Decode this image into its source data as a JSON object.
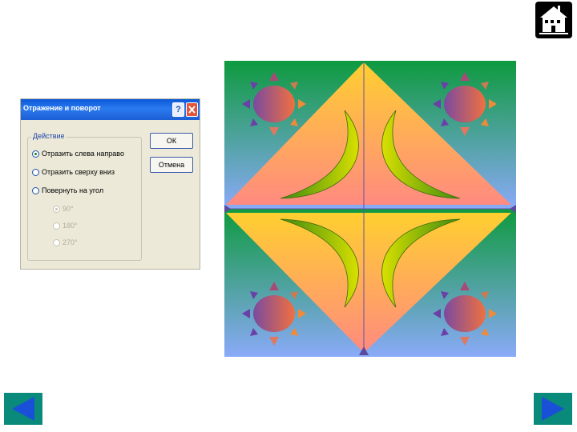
{
  "home": {
    "icon": "house-icon"
  },
  "dialog": {
    "title": "Отражение и поворот",
    "help_label": "?",
    "close_icon": "close-icon",
    "group_label": "Действие",
    "options": [
      {
        "label": "Отразить слева направо",
        "checked": true,
        "enabled": true
      },
      {
        "label": "Отразить сверху вниз",
        "checked": false,
        "enabled": true
      },
      {
        "label": "Повернуть на угол",
        "checked": false,
        "enabled": true
      }
    ],
    "angles": [
      {
        "label": "90°",
        "checked": true,
        "enabled": false
      },
      {
        "label": "180°",
        "checked": false,
        "enabled": false
      },
      {
        "label": "270°",
        "checked": false,
        "enabled": false
      }
    ],
    "ok_label": "ОК",
    "cancel_label": "Отмена"
  },
  "colors": {
    "teal_green": "#1a9a4a",
    "blue": "#8aaaf8",
    "yellow": "#ffc73a",
    "salmon": "#ff8a78",
    "crescent_light": "#c8d800",
    "crescent_dark": "#3e8a0a",
    "sun_body": "#a05060",
    "ray_purple": "#6a40a8",
    "ray_orange": "#f08a38",
    "nav_bg": "#0a8a7a",
    "nav_arrow": "#1a4fd8"
  },
  "nav": {
    "prev_icon": "arrow-left-icon",
    "next_icon": "arrow-right-icon"
  }
}
